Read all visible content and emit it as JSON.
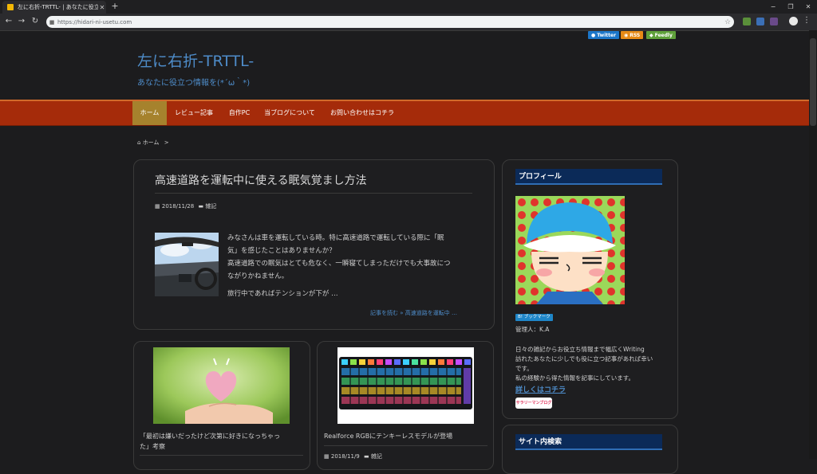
{
  "browser": {
    "tab_title": "左に右折-TRTTL- | あなたに役立つ情",
    "url": "https://hidari-ni-usetu.com",
    "new_tab_label": "+",
    "win_min": "−",
    "win_restore": "❐",
    "win_close": "✕"
  },
  "social": {
    "twitter": "Twitter",
    "rss": "RSS",
    "feedly": "Feedly"
  },
  "site": {
    "title": "左に右折-TRTTL-",
    "description": "あなたに役立つ情報を(*´ω｀*)"
  },
  "nav": {
    "items": [
      "ホーム",
      "レビュー記事",
      "自作PC",
      "当ブログについて",
      "お問い合わせはコチラ"
    ]
  },
  "breadcrumb": {
    "home": "ホーム",
    "sep": ">"
  },
  "main_post": {
    "title": "高速道路を運転中に使える眠気覚まし方法",
    "date": "2018/11/28",
    "category": "雑記",
    "excerpt_lines": [
      "みなさんは車を運転している時。特に高速道路で運転している際に「眠",
      "気」を感じたことはありませんか？",
      "高速道路での眠気はとても危なく、一瞬寝てしまっただけでも大事故につ",
      "ながりかねません。",
      "旅行中であればテンションが下が …"
    ],
    "read_more": "記事を読む »  高速道路を運転中 …"
  },
  "card_left": {
    "title_line1": "「最初は嫌いだったけど次第に好きになっちゃっ",
    "title_line2": "た」考察"
  },
  "card_right": {
    "title": "Realforce RGBにテンキーレスモデルが登場",
    "date": "2018/11/9",
    "category": "雑記"
  },
  "sidebar": {
    "profile_heading": "プロフィール",
    "bookmark_badge": "B! ブックマーク",
    "admin": "管理人：K.A",
    "bio_lines": [
      "日々の雑記からお役立ち情報まで幅広くWriting",
      "訪れたあなたに少しでも役に立つ記事があれば幸い",
      "です。",
      "私の経験から得た情報を記事にしています。"
    ],
    "detail_link": "詳しくはコチラ",
    "blog_badge": "サラリーマンブログ",
    "search_heading": "サイト内検索"
  },
  "colors": {
    "accent_blue": "#4e8cc9",
    "nav_bg": "#a52b0a",
    "nav_active": "#a6822d",
    "widget_head": "#0b2a58"
  }
}
